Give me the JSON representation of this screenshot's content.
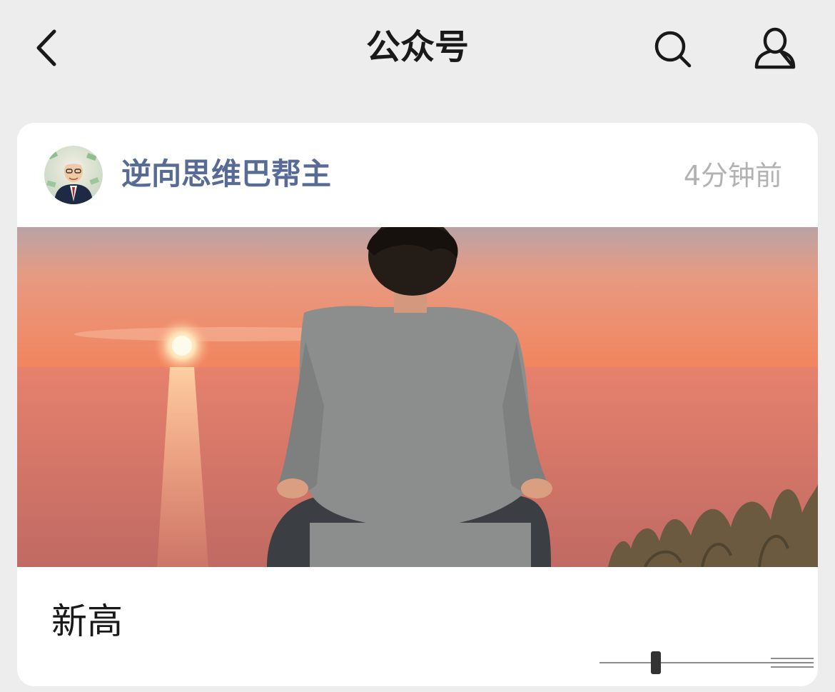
{
  "nav": {
    "title": "公众号",
    "back_icon": "chevron-left-icon",
    "search_icon": "search-icon",
    "profile_icon": "person-icon"
  },
  "post": {
    "account_name": "逆向思维巴帮主",
    "time": "4分钟前",
    "cover_description_icon": "cover-image",
    "title": "新高"
  },
  "colors": {
    "page_bg": "#ededed",
    "card_bg": "#ffffff",
    "account_name": "#576b95",
    "time": "#b2b2b2",
    "title": "#191919"
  }
}
